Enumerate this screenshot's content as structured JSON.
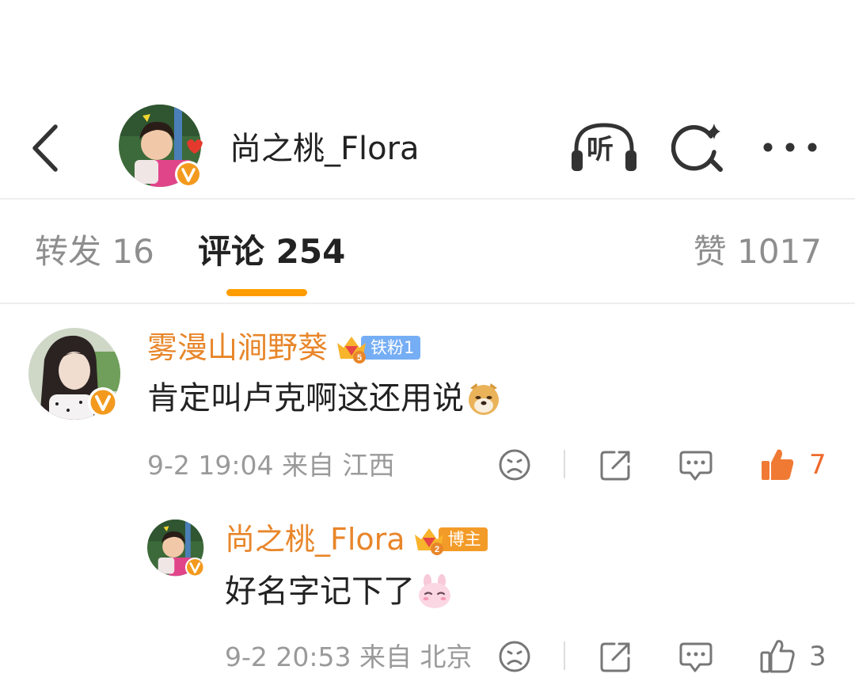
{
  "header": {
    "username": "尚之桃_Flora",
    "listen_label": "听"
  },
  "tabs": [
    {
      "label": "转发 16"
    },
    {
      "label": "评论 254"
    },
    {
      "label": "赞 1017"
    }
  ],
  "comments": [
    {
      "author": "雾漫山涧野葵",
      "badge_label": "铁粉1",
      "badge_level": "5",
      "text": "肯定叫卢克啊这还用说",
      "time_location": "9-2 19:04 来自 江西",
      "likes": "7",
      "liked": true
    },
    {
      "author": "尚之桃_Flora",
      "badge_label": "博主",
      "badge_level": "2",
      "text": "好名字记下了",
      "time_location": "9-2 20:53 来自 北京",
      "likes": "3",
      "liked": false
    }
  ],
  "colors": {
    "accent": "#ff9d00",
    "author_name": "#e8862a",
    "like_active": "#ef6a2d",
    "fan_badge_blue": "#76aef5",
    "blogger_badge_orange": "#f39b29",
    "text_primary": "#222222",
    "text_secondary": "#9a9a9a"
  },
  "icons": [
    "back-arrow-icon",
    "headphones-listen-icon",
    "search-sparkle-icon",
    "more-dots-icon",
    "verified-v-icon",
    "crown-diamond-icon",
    "dislike-face-icon",
    "share-icon",
    "comment-icon",
    "thumbs-up-icon",
    "doge-emoji-icon",
    "bunny-emoji-icon"
  ]
}
